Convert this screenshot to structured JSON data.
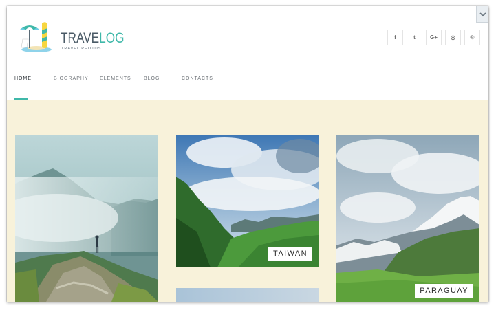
{
  "brand": {
    "title_part1": "TRAVE",
    "title_part2": "LOG",
    "subtitle": "TRAVEL PHOTOS"
  },
  "social": [
    {
      "icon": "facebook-icon",
      "glyph": "f"
    },
    {
      "icon": "twitter-icon",
      "glyph": "t"
    },
    {
      "icon": "google-plus-icon",
      "glyph": "G+"
    },
    {
      "icon": "instagram-icon",
      "glyph": "◎"
    },
    {
      "icon": "pinterest-icon",
      "glyph": "℗"
    }
  ],
  "nav": {
    "items": [
      {
        "label": "HOME",
        "active": true
      },
      {
        "label": "BIOGRAPHY",
        "active": false
      },
      {
        "label": "ELEMENTS",
        "active": false
      },
      {
        "label": "BLOG",
        "active": false
      },
      {
        "label": "CONTACTS",
        "active": false
      }
    ]
  },
  "gallery": {
    "cards": [
      {
        "label": ""
      },
      {
        "label": "TAIWAN"
      },
      {
        "label": "PARAGUAY"
      },
      {
        "label": ""
      }
    ]
  },
  "colors": {
    "accent": "#3fb8a9",
    "content_bg": "#f8f2da"
  }
}
